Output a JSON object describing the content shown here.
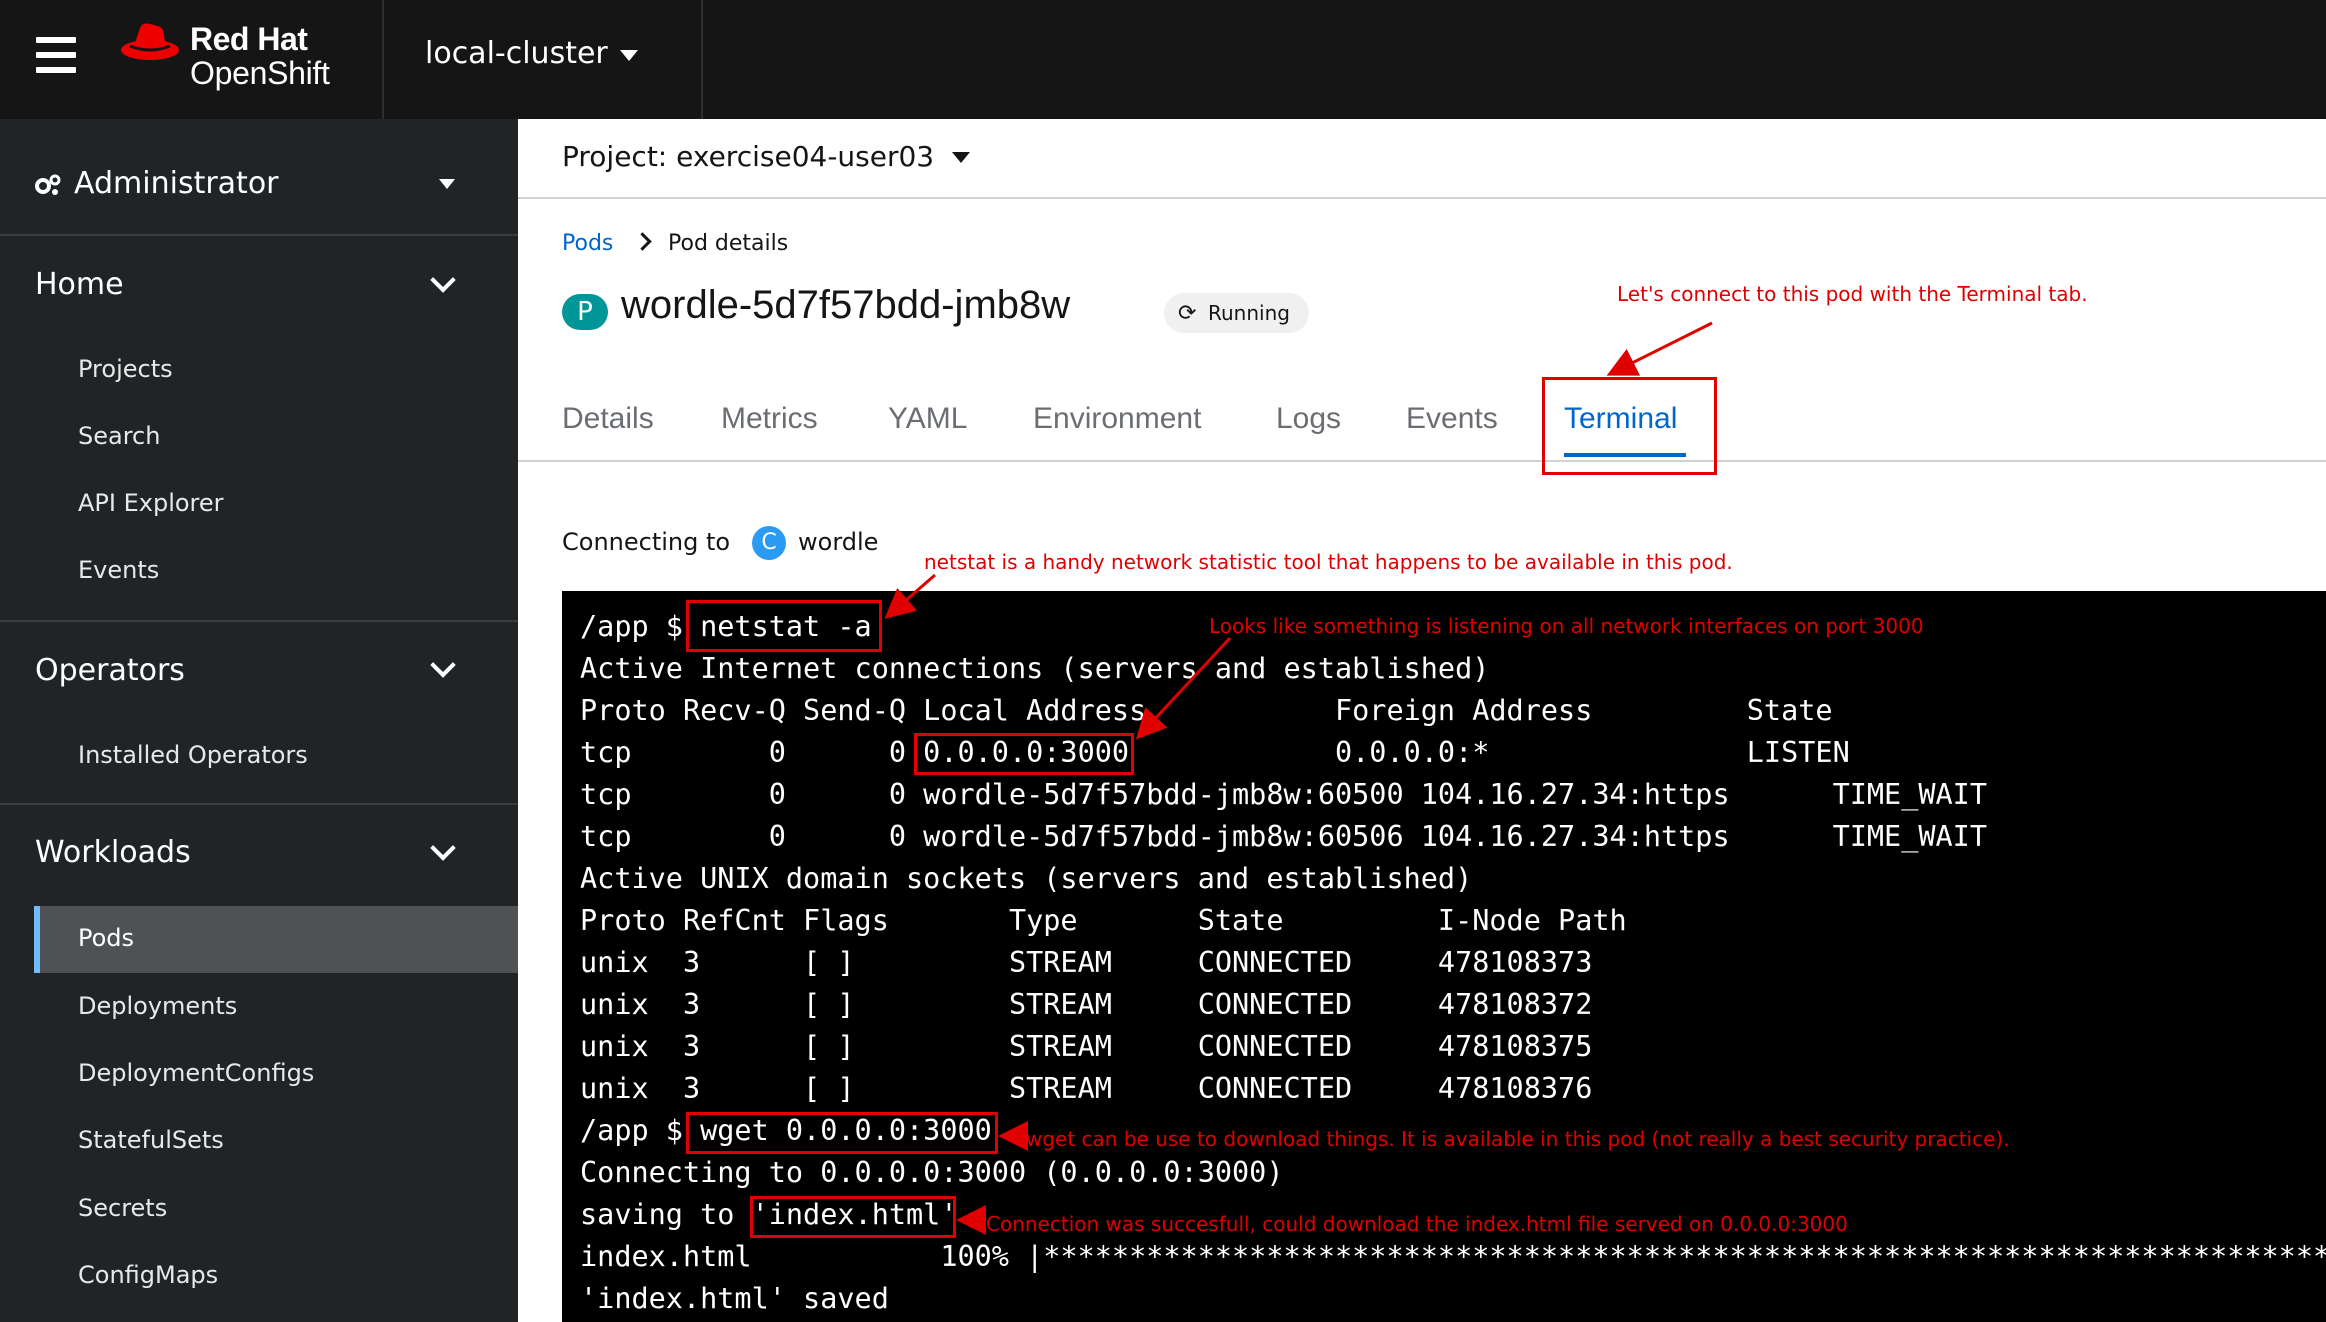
{
  "masthead": {
    "brand_line1": "Red Hat",
    "brand_line2": "OpenShift",
    "cluster": "local-cluster"
  },
  "sidebar": {
    "perspective": "Administrator",
    "sections": [
      {
        "title": "Home",
        "items": [
          "Projects",
          "Search",
          "API Explorer",
          "Events"
        ]
      },
      {
        "title": "Operators",
        "items": [
          "Installed Operators"
        ]
      },
      {
        "title": "Workloads",
        "items": [
          "Pods",
          "Deployments",
          "DeploymentConfigs",
          "StatefulSets",
          "Secrets",
          "ConfigMaps"
        ]
      }
    ],
    "active_item": "Pods"
  },
  "project": {
    "label": "Project: exercise04-user03"
  },
  "breadcrumb": {
    "link": "Pods",
    "current": "Pod details"
  },
  "pod": {
    "badge": "P",
    "name": "wordle-5d7f57bdd-jmb8w",
    "status": "Running"
  },
  "tabs": [
    "Details",
    "Metrics",
    "YAML",
    "Environment",
    "Logs",
    "Events",
    "Terminal"
  ],
  "active_tab": "Terminal",
  "terminal_header": {
    "label": "Connecting to",
    "container_badge": "C",
    "container": "wordle"
  },
  "terminal": {
    "lines": [
      "/app $ netstat -a",
      "Active Internet connections (servers and established)",
      "Proto Recv-Q Send-Q Local Address           Foreign Address         State",
      "tcp        0      0 0.0.0.0:3000            0.0.0.0:*               LISTEN",
      "tcp        0      0 wordle-5d7f57bdd-jmb8w:60500 104.16.27.34:https      TIME_WAIT",
      "tcp        0      0 wordle-5d7f57bdd-jmb8w:60506 104.16.27.34:https      TIME_WAIT",
      "Active UNIX domain sockets (servers and established)",
      "Proto RefCnt Flags       Type       State         I-Node Path",
      "unix  3      [ ]         STREAM     CONNECTED     478108373",
      "unix  3      [ ]         STREAM     CONNECTED     478108372",
      "unix  3      [ ]         STREAM     CONNECTED     478108375",
      "unix  3      [ ]         STREAM     CONNECTED     478108376",
      "/app $ wget 0.0.0.0:3000",
      "Connecting to 0.0.0.0:3000 (0.0.0.0:3000)",
      "saving to 'index.html'",
      "index.html           100% |*******************************************************************************",
      "'index.html' saved"
    ]
  },
  "annotations": {
    "terminal_tab": "Let's connect to this pod with the Terminal tab.",
    "netstat": "netstat is a handy network statistic tool that happens to be available in this pod.",
    "listening": "Looks like something is listening on all network interfaces on port 3000",
    "wget": "wget can be use to download things. It is available in this pod (not really a best security practice).",
    "download": "Connection was succesfull, could download the index.html file served on 0.0.0.0:3000"
  },
  "colors": {
    "masthead": "#151515",
    "sidebar": "#212427",
    "link": "#0066cc",
    "annotation": "#e00000",
    "terminal_bg": "#000000"
  }
}
